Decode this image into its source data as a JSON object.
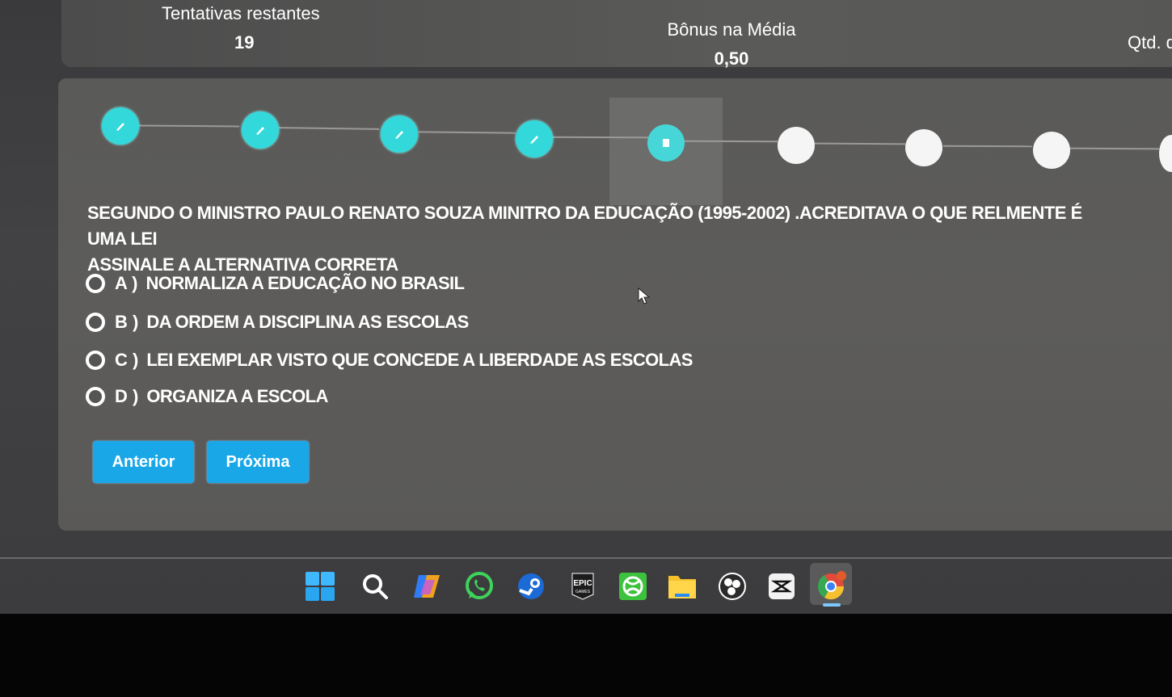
{
  "stats": {
    "attempts_label": "Tentativas restantes",
    "attempts_value": "19",
    "bonus_label": "Bônus na Média",
    "bonus_value": "0,50",
    "qtd_label": "Qtd. d"
  },
  "stepper": {
    "completed_steps": 4,
    "current_step": 5,
    "total_visible_steps": 9
  },
  "question": {
    "text": "SEGUNDO O MINISTRO PAULO RENATO SOUZA MINITRO DA EDUCAÇÃO (1995-2002) .ACREDITAVA O QUE RELMENTE É UMA LEI",
    "instruction": "ASSINALE A ALTERNATIVA CORRETA"
  },
  "options": [
    {
      "letter": "A )",
      "text": "NORMALIZA A EDUCAÇÃO NO BRASIL"
    },
    {
      "letter": "B )",
      "text": "DA ORDEM A DISCIPLINA AS ESCOLAS"
    },
    {
      "letter": "C )",
      "text": "LEI EXEMPLAR VISTO QUE CONCEDE A LIBERDADE AS ESCOLAS"
    },
    {
      "letter": "D )",
      "text": "ORGANIZA A ESCOLA"
    }
  ],
  "buttons": {
    "previous": "Anterior",
    "next": "Próxima"
  },
  "colors": {
    "accent": "#1aa7e8",
    "step_done": "#33d8da",
    "step_todo": "#f5f5f5"
  },
  "taskbar": {
    "icons": [
      "windows-start-icon",
      "search-icon",
      "copilot-icon",
      "whatsapp-icon",
      "steam-icon",
      "epic-games-icon",
      "xbox-icon",
      "file-explorer-icon",
      "obs-icon",
      "capcut-icon",
      "chrome-icon"
    ],
    "active": "chrome-icon"
  }
}
